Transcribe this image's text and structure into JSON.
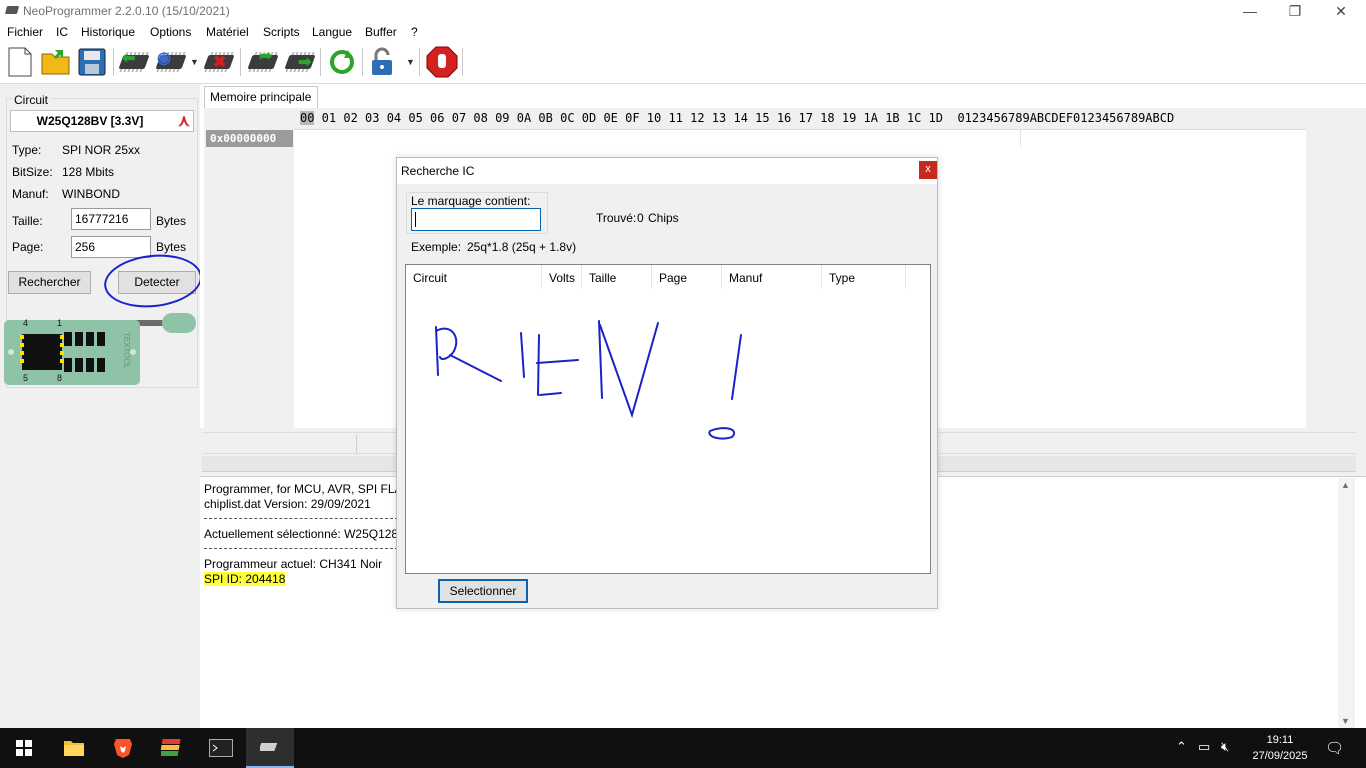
{
  "window": {
    "title": "NeoProgrammer 2.2.0.10 (15/10/2021)",
    "minimize": "—",
    "restore": "❐",
    "close": "✕"
  },
  "menu": [
    "Fichier",
    "IC",
    "Historique",
    "Options",
    "Matériel",
    "Scripts",
    "Langue",
    "Buffer",
    "?"
  ],
  "circuit": {
    "group_label": "Circuit",
    "name": "W25Q128BV [3.3V]",
    "type_label": "Type:",
    "type_value": "SPI NOR  25xx",
    "bitsize_label": "BitSize:",
    "bitsize_value": "128 Mbits",
    "manuf_label": "Manuf:",
    "manuf_value": "WINBOND",
    "size_label": "Taille:",
    "size_value": "16777216",
    "size_unit": "Bytes",
    "page_label": "Page:",
    "page_value": "256",
    "page_unit": "Bytes",
    "search_button": "Rechercher",
    "detect_button": "Detecter",
    "socket_pins": {
      "tl": "4",
      "tr": "1",
      "bl": "5",
      "br": "8"
    },
    "socket_text": "TEXTOOL"
  },
  "memory": {
    "tab": "Memoire principale",
    "header_first": "00",
    "header_rest": " 01 02 03 04 05 06 07 08 09 0A 0B 0C 0D 0E 0F 10 11 12 13 14 15 16 17 18 19 1A 1B 1C 1D",
    "header_ascii": "0123456789ABCDEF0123456789ABCD",
    "address": "0x00000000"
  },
  "log": {
    "line1": "Programmer, for MCU, AVR, SPI FLASH",
    "line2": "chiplist.dat Version: 29/09/2021",
    "line3": "Actuellement sélectionné:  W25Q128",
    "line4": "Programmeur actuel: CH341 Noir",
    "line5": "SPI ID: 204418"
  },
  "dialog": {
    "title": "Recherche IC",
    "close": "x",
    "search_label": "Le marquage contient:",
    "search_value": "",
    "found_label": "Trouvé:",
    "found_count": "0",
    "found_unit": "Chips",
    "example_label": "Exemple:",
    "example_value": "25q*1.8 (25q + 1.8v)",
    "columns": [
      "Circuit",
      "Volts",
      "Taille",
      "Page",
      "Manuf",
      "Type"
    ],
    "select_button": "Selectionner"
  },
  "taskbar": {
    "time": "19:11",
    "date": "27/09/2025"
  },
  "colors": {
    "annotation": "#1a23c8",
    "highlight": "#ffff3c",
    "accent": "#0a64ad",
    "stop": "#d32222"
  }
}
